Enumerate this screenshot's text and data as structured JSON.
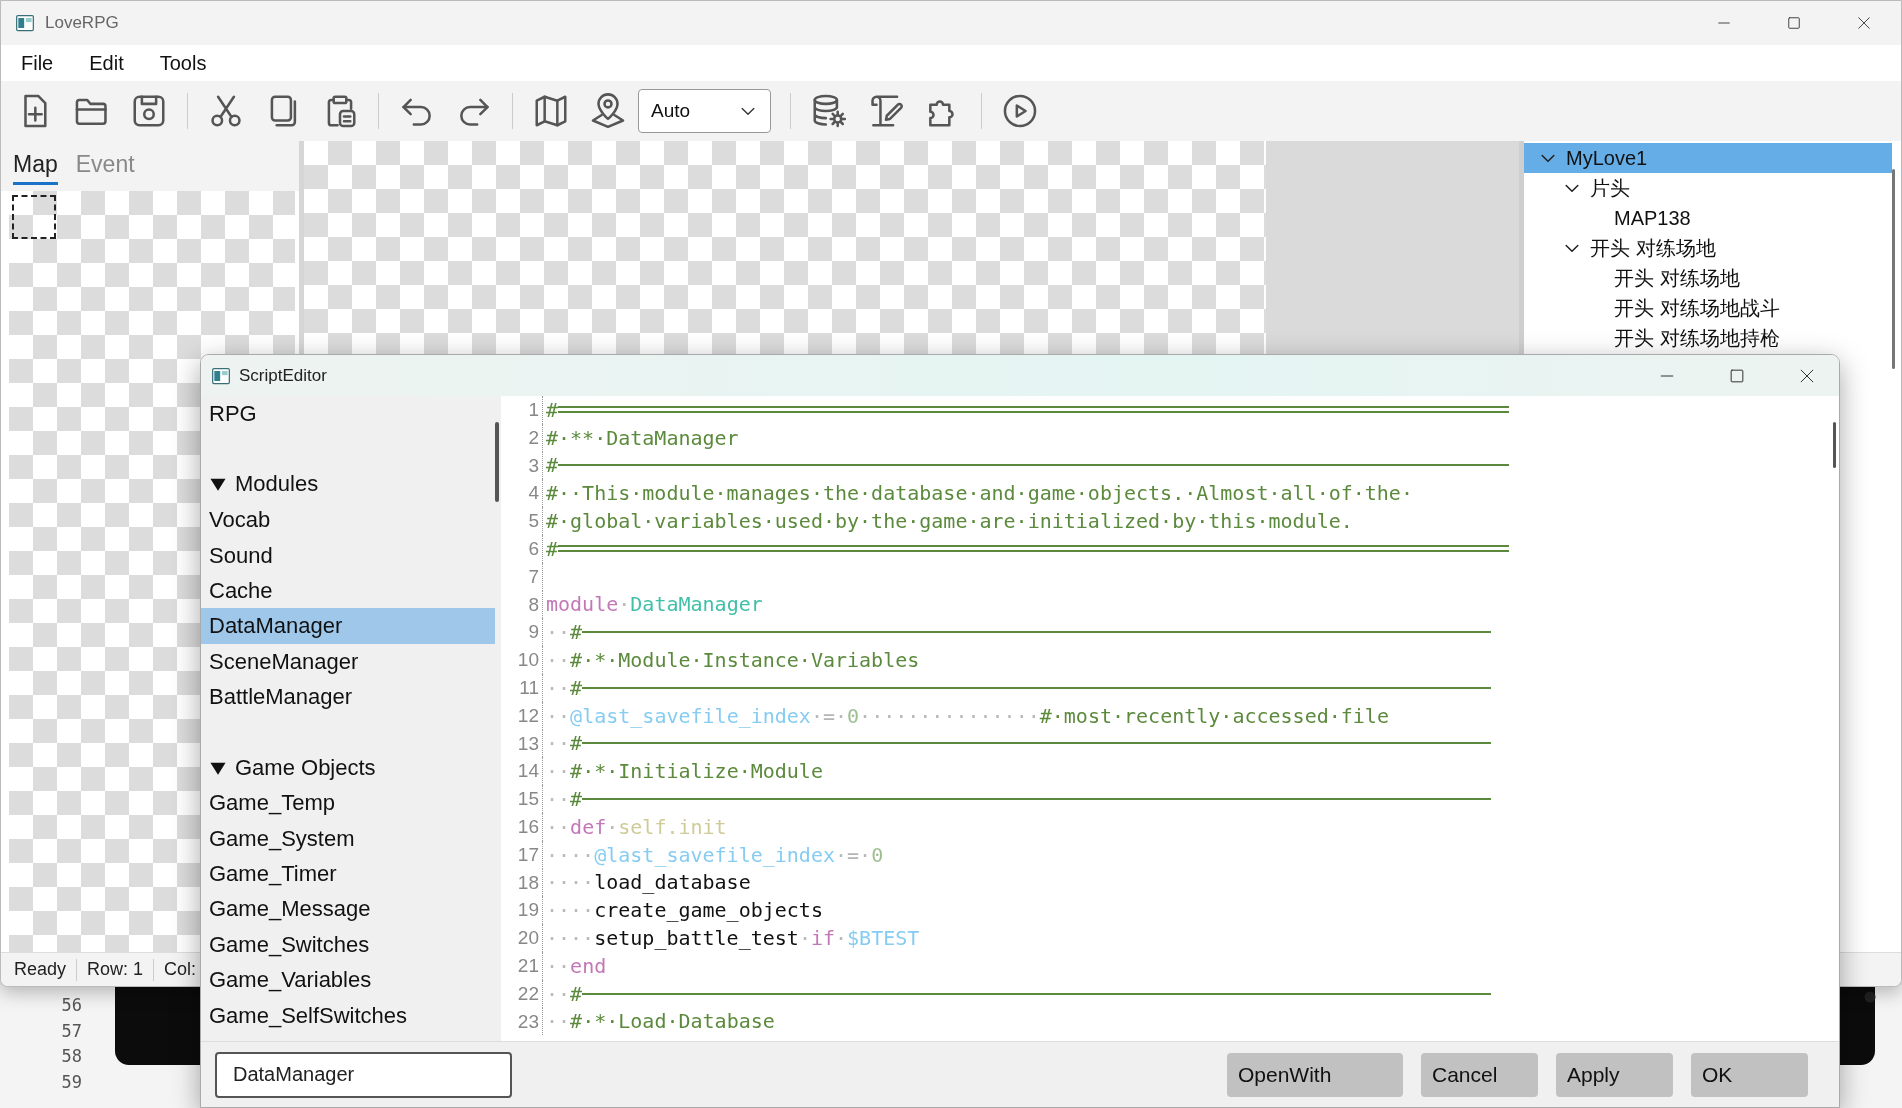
{
  "main_window": {
    "title": "LoveRPG",
    "menu": [
      "File",
      "Edit",
      "Tools"
    ],
    "toolbar": {
      "zoom_dropdown": {
        "value": "Auto"
      }
    },
    "panel_tabs": [
      {
        "label": "Map",
        "selected": true
      },
      {
        "label": "Event",
        "selected": false
      }
    ],
    "map_tree": [
      {
        "label": "MyLove1",
        "expanded": true,
        "selected": true,
        "children": [
          {
            "label": "片头",
            "expanded": true,
            "selected": false,
            "children": [
              {
                "label": "MAP138",
                "selected": false
              }
            ]
          },
          {
            "label": "开头 对练场地",
            "expanded": true,
            "selected": false,
            "children": [
              {
                "label": "开头 对练场地",
                "selected": false
              },
              {
                "label": "开头 对练场地战斗",
                "selected": false
              },
              {
                "label": "开头 对练场地持枪",
                "selected": false
              }
            ]
          }
        ]
      }
    ],
    "status_bar": [
      "Ready",
      "Row: 1",
      "Col:"
    ]
  },
  "background_window": {
    "line_numbers": [
      "56",
      "57",
      "58",
      "59"
    ]
  },
  "script_editor": {
    "title": "ScriptEditor",
    "script_list": [
      {
        "kind": "item",
        "label": "RPG",
        "selected": false
      },
      {
        "kind": "group",
        "label": "Modules",
        "expanded": true,
        "children": [
          {
            "label": "Vocab",
            "selected": false
          },
          {
            "label": "Sound",
            "selected": false
          },
          {
            "label": "Cache",
            "selected": false
          },
          {
            "label": "DataManager",
            "selected": true
          },
          {
            "label": "SceneManager",
            "selected": false
          },
          {
            "label": "BattleManager",
            "selected": false
          }
        ]
      },
      {
        "kind": "group",
        "label": "Game Objects",
        "expanded": true,
        "children": [
          {
            "label": "Game_Temp",
            "selected": false
          },
          {
            "label": "Game_System",
            "selected": false
          },
          {
            "label": "Game_Timer",
            "selected": false
          },
          {
            "label": "Game_Message",
            "selected": false
          },
          {
            "label": "Game_Switches",
            "selected": false
          },
          {
            "label": "Game_Variables",
            "selected": false
          },
          {
            "label": "Game_SelfSwitches",
            "selected": false
          }
        ]
      }
    ],
    "code_lines": [
      {
        "number": "1",
        "segments": [
          {
            "kind": "comment",
            "text": "#"
          },
          {
            "kind": "rule-double"
          }
        ]
      },
      {
        "number": "2",
        "segments": [
          {
            "kind": "comment",
            "text": "#·**·DataManager"
          }
        ]
      },
      {
        "number": "3",
        "segments": [
          {
            "kind": "comment",
            "text": "#"
          },
          {
            "kind": "rule-wide"
          }
        ]
      },
      {
        "number": "4",
        "segments": [
          {
            "kind": "comment",
            "text": "#··This·module·manages·the·database·and·game·objects.·Almost·all·of·the·"
          }
        ]
      },
      {
        "number": "5",
        "segments": [
          {
            "kind": "comment",
            "text": "#·global·variables·used·by·the·game·are·initialized·by·this·module."
          }
        ]
      },
      {
        "number": "6",
        "segments": [
          {
            "kind": "comment",
            "text": "#"
          },
          {
            "kind": "rule-double"
          }
        ]
      },
      {
        "number": "7"
      },
      {
        "number": "8",
        "segments": [
          {
            "kind": "keyword",
            "text": "module"
          },
          {
            "kind": "space",
            "text": "·"
          },
          {
            "kind": "constant",
            "text": "DataManager"
          }
        ]
      },
      {
        "number": "9",
        "segments": [
          {
            "kind": "space",
            "text": "··"
          },
          {
            "kind": "comment",
            "text": "#"
          },
          {
            "kind": "rule"
          }
        ]
      },
      {
        "number": "10",
        "segments": [
          {
            "kind": "space",
            "text": "··"
          },
          {
            "kind": "comment",
            "text": "#·*·Module·Instance·Variables"
          }
        ]
      },
      {
        "number": "11",
        "segments": [
          {
            "kind": "space",
            "text": "··"
          },
          {
            "kind": "comment",
            "text": "#"
          },
          {
            "kind": "rule"
          }
        ]
      },
      {
        "number": "12",
        "segments": [
          {
            "kind": "space",
            "text": "··"
          },
          {
            "kind": "ivar",
            "text": "@last_savefile_index"
          },
          {
            "kind": "space",
            "text": "·"
          },
          {
            "kind": "operator",
            "text": "="
          },
          {
            "kind": "space",
            "text": "·"
          },
          {
            "kind": "number",
            "text": "0"
          },
          {
            "kind": "space",
            "text": "···············"
          },
          {
            "kind": "comment",
            "text": "#·most·recently·accessed·file"
          }
        ]
      },
      {
        "number": "13",
        "segments": [
          {
            "kind": "space",
            "text": "··"
          },
          {
            "kind": "comment",
            "text": "#"
          },
          {
            "kind": "rule"
          }
        ]
      },
      {
        "number": "14",
        "segments": [
          {
            "kind": "space",
            "text": "··"
          },
          {
            "kind": "comment",
            "text": "#·*·Initialize·Module"
          }
        ]
      },
      {
        "number": "15",
        "segments": [
          {
            "kind": "space",
            "text": "··"
          },
          {
            "kind": "comment",
            "text": "#"
          },
          {
            "kind": "rule"
          }
        ]
      },
      {
        "number": "16",
        "segments": [
          {
            "kind": "space",
            "text": "··"
          },
          {
            "kind": "keyword",
            "text": "def"
          },
          {
            "kind": "space",
            "text": "·"
          },
          {
            "kind": "method",
            "text": "self.init"
          }
        ]
      },
      {
        "number": "17",
        "segments": [
          {
            "kind": "space",
            "text": "····"
          },
          {
            "kind": "ivar",
            "text": "@last_savefile_index"
          },
          {
            "kind": "space",
            "text": "·"
          },
          {
            "kind": "operator",
            "text": "="
          },
          {
            "kind": "space",
            "text": "·"
          },
          {
            "kind": "number",
            "text": "0"
          }
        ]
      },
      {
        "number": "18",
        "segments": [
          {
            "kind": "space",
            "text": "····"
          },
          {
            "kind": "plain",
            "text": "load_database"
          }
        ]
      },
      {
        "number": "19",
        "segments": [
          {
            "kind": "space",
            "text": "····"
          },
          {
            "kind": "plain",
            "text": "create_game_objects"
          }
        ]
      },
      {
        "number": "20",
        "segments": [
          {
            "kind": "space",
            "text": "····"
          },
          {
            "kind": "plain",
            "text": "setup_battle_test"
          },
          {
            "kind": "space",
            "text": "·"
          },
          {
            "kind": "keyword",
            "text": "if"
          },
          {
            "kind": "space",
            "text": "·"
          },
          {
            "kind": "ivar",
            "text": "$BTEST"
          }
        ]
      },
      {
        "number": "21",
        "segments": [
          {
            "kind": "space",
            "text": "··"
          },
          {
            "kind": "keyword",
            "text": "end"
          }
        ]
      },
      {
        "number": "22",
        "segments": [
          {
            "kind": "space",
            "text": "··"
          },
          {
            "kind": "comment",
            "text": "#"
          },
          {
            "kind": "rule"
          }
        ]
      },
      {
        "number": "23",
        "segments": [
          {
            "kind": "space",
            "text": "··"
          },
          {
            "kind": "comment",
            "text": "#·*·Load·Database"
          }
        ]
      }
    ],
    "name_field": {
      "value": "DataManager"
    },
    "buttons": [
      "OpenWith",
      "Cancel",
      "Apply",
      "OK"
    ]
  }
}
